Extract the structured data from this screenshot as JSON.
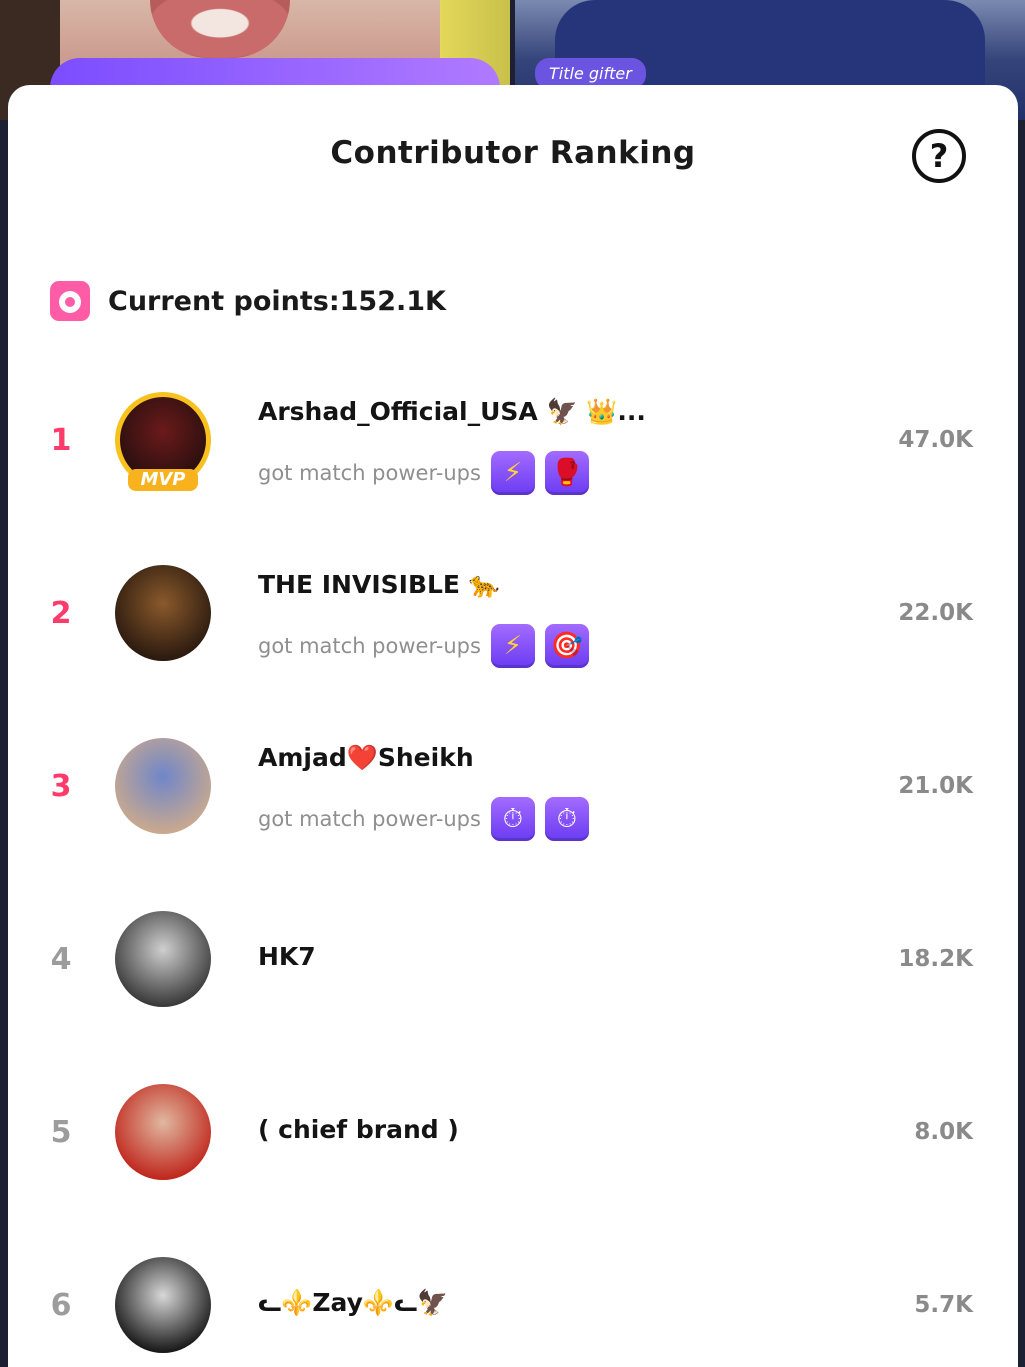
{
  "background": {
    "right_tag": "Title gifter"
  },
  "sheet": {
    "title": "Contributor Ranking",
    "help_icon": "?",
    "points_label": "Current points:152.1K"
  },
  "powerups_label": "got match power-ups",
  "ranking": [
    {
      "rank": "1",
      "name": "Arshad_Official_USA 🦅 👑...",
      "badge": "MVP",
      "has_powerups": true,
      "powerups": [
        "lightning-icon",
        "glove-icon"
      ],
      "powerup_glyphs": [
        "⚡",
        "🥊"
      ],
      "score": "47.0K",
      "avatar_colors": [
        "#6b1a1a",
        "#2a0f0f"
      ]
    },
    {
      "rank": "2",
      "name": "THE INVISIBLE 🐆",
      "badge": "",
      "has_powerups": true,
      "powerups": [
        "lightning-icon",
        "target-icon"
      ],
      "powerup_glyphs": [
        "⚡",
        "🎯"
      ],
      "score": "22.0K",
      "avatar_colors": [
        "#8a5a2b",
        "#2b1a0f"
      ]
    },
    {
      "rank": "3",
      "name": "Amjad❤️Sheikh",
      "badge": "",
      "has_powerups": true,
      "powerups": [
        "timer-icon",
        "timer-icon"
      ],
      "powerup_glyphs": [
        "⏱",
        "⏱"
      ],
      "score": "21.0K",
      "avatar_colors": [
        "#6f86c9",
        "#c9a98f"
      ]
    },
    {
      "rank": "4",
      "name": "HK7",
      "badge": "",
      "has_powerups": false,
      "powerups": [],
      "powerup_glyphs": [],
      "score": "18.2K",
      "avatar_colors": [
        "#cfcfcf",
        "#3a3a3a"
      ]
    },
    {
      "rank": "5",
      "name": "( chief brand )",
      "badge": "",
      "has_powerups": false,
      "powerups": [],
      "powerup_glyphs": [],
      "score": "8.0K",
      "avatar_colors": [
        "#e0b8a0",
        "#c0281e"
      ]
    },
    {
      "rank": "6",
      "name": "ᓚ⚜️Zay⚜️ᓚ🦅",
      "badge": "",
      "has_powerups": false,
      "powerups": [],
      "powerup_glyphs": [],
      "score": "5.7K",
      "avatar_colors": [
        "#d8d8d8",
        "#1a1a1a"
      ]
    }
  ],
  "colors": {
    "top_rank": "#ff3b6b",
    "other_rank": "#9c9c9c",
    "powerup_purple": "#7b4dff",
    "mvp_gold": "#f7c21e",
    "points_pink": "#ff5ca8"
  }
}
